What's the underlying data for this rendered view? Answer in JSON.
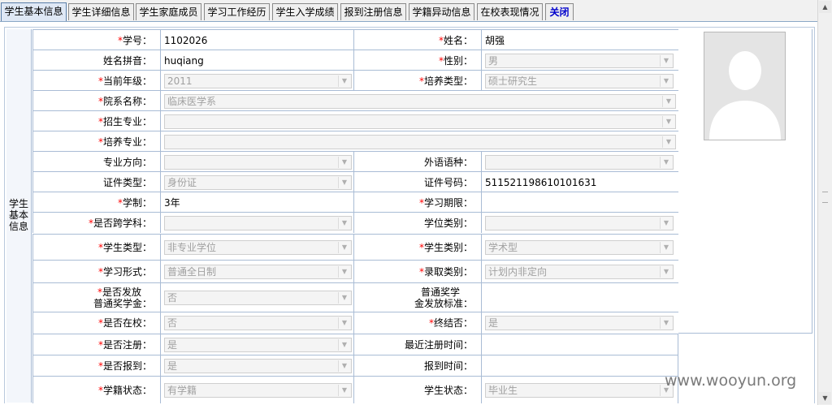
{
  "tabs": [
    {
      "label": "学生基本信息",
      "active": true
    },
    {
      "label": "学生详细信息"
    },
    {
      "label": "学生家庭成员"
    },
    {
      "label": "学习工作经历"
    },
    {
      "label": "学生入学成绩"
    },
    {
      "label": "报到注册信息"
    },
    {
      "label": "学籍异动信息"
    },
    {
      "label": "在校表现情况"
    },
    {
      "label": "关闭"
    }
  ],
  "section_label": "学生基本信息",
  "required_mark": "*",
  "fields": {
    "student_id": {
      "label": "学号：",
      "value": "1102026"
    },
    "name": {
      "label": "姓名：",
      "value": "胡强"
    },
    "pinyin": {
      "label": "姓名拼音：",
      "value": "huqiang"
    },
    "gender": {
      "label": "性别：",
      "value": "男"
    },
    "grade": {
      "label": "当前年级：",
      "value": "2011"
    },
    "training_type": {
      "label": "培养类型：",
      "value": "硕士研究生"
    },
    "department": {
      "label": "院系名称：",
      "value": "临床医学系"
    },
    "enroll_major": {
      "label": "招生专业：",
      "value": ""
    },
    "train_major": {
      "label": "培养专业：",
      "value": ""
    },
    "major_direction": {
      "label": "专业方向：",
      "value": ""
    },
    "foreign_language": {
      "label": "外语语种：",
      "value": ""
    },
    "id_type": {
      "label": "证件类型：",
      "value": "身份证"
    },
    "id_number": {
      "label": "证件号码：",
      "value": "511521198610101631"
    },
    "duration": {
      "label": "学制：",
      "value": "3年"
    },
    "study_period": {
      "label": "学习期限：",
      "value": ""
    },
    "cross_discipline": {
      "label": "是否跨学科：",
      "value": ""
    },
    "degree_category": {
      "label": "学位类别：",
      "value": ""
    },
    "student_type": {
      "label": "学生类型：",
      "value": "非专业学位"
    },
    "student_category": {
      "label": "学生类别：",
      "value": "学术型"
    },
    "study_form": {
      "label": "学习形式：",
      "value": "普通全日制"
    },
    "admission_category": {
      "label": "录取类别：",
      "value": "计划内非定向"
    },
    "scholarship": {
      "label1": "是否发放",
      "label2": "普通奖学金：",
      "value": "否"
    },
    "scholarship_standard": {
      "label1": "普通奖学",
      "label2": "金发放标准：",
      "value": ""
    },
    "in_school": {
      "label": "是否在校：",
      "value": "否"
    },
    "graduated": {
      "label": "终结否：",
      "value": "是"
    },
    "registered": {
      "label": "是否注册：",
      "value": "是"
    },
    "last_register_time": {
      "label": "最近注册时间：",
      "value": ""
    },
    "reported": {
      "label": "是否报到：",
      "value": "是"
    },
    "report_time": {
      "label": "报到时间：",
      "value": ""
    },
    "enrollment_status": {
      "label": "学籍状态：",
      "value": "有学籍"
    },
    "student_status": {
      "label": "学生状态：",
      "value": "毕业生"
    }
  },
  "watermark": "www.wooyun.org"
}
